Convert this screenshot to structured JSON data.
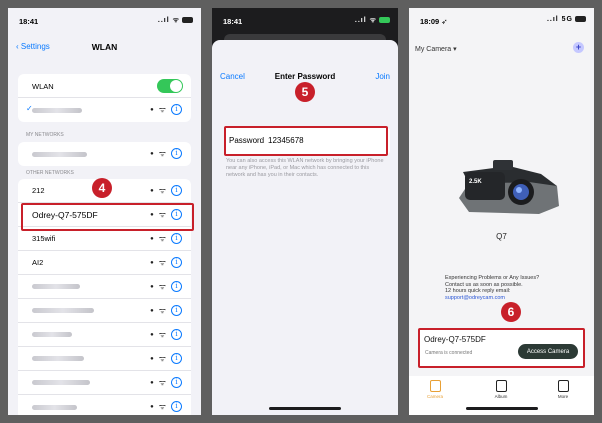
{
  "screen1": {
    "status_time": "18:41",
    "status_icons": "..ıl ᯤ",
    "back_label": "Settings",
    "title": "WLAN",
    "wlan_label": "WLAN",
    "my_networks_header": "MY NETWORKS",
    "other_networks_header": "OTHER NETWORKS",
    "networks": [
      {
        "name": "212"
      },
      {
        "name": "Odrey-Q7-575DF"
      },
      {
        "name": "315wifi"
      },
      {
        "name": "AI2"
      }
    ],
    "step_badge": "4",
    "lock_glyph": "🔒",
    "wifi_glyph": "ᯤ",
    "info_glyph": "i",
    "toggle_color": "#34c759",
    "accent_color": "#0a7aff",
    "highlight_color": "#c8202a"
  },
  "screen2": {
    "status_time": "18:41",
    "status_icons": "..ıl ᯤ",
    "cancel_label": "Cancel",
    "title": "Enter Password",
    "join_label": "Join",
    "password_label": "Password",
    "password_value": "12345678",
    "hint": "You can also access this WLAN network by bringing your iPhone near any iPhone, iPad, or Mac which has connected to this network and has you in their contacts.",
    "step_badge": "5"
  },
  "screen3": {
    "status_time": "18:09 ➶",
    "status_icons": "..ıl 5G",
    "header_label": "My Camera ▾",
    "add_glyph": "+",
    "lens_label": "2.5K",
    "model": "Q7",
    "help_line1": "Experiencing Problems or Any Issues?",
    "help_line2": "Contact us as soon as possible.",
    "help_line3": "12 hours quick reply email:",
    "help_email": "support@odreycam.com",
    "step_badge": "6",
    "device_name": "Odrey-Q7-575DF",
    "device_status": "Camera is connected",
    "access_label": "Access Camera",
    "tabs": [
      {
        "label": "Camera"
      },
      {
        "label": "Album"
      },
      {
        "label": "More"
      }
    ],
    "active_tab_color": "#e8a035"
  }
}
